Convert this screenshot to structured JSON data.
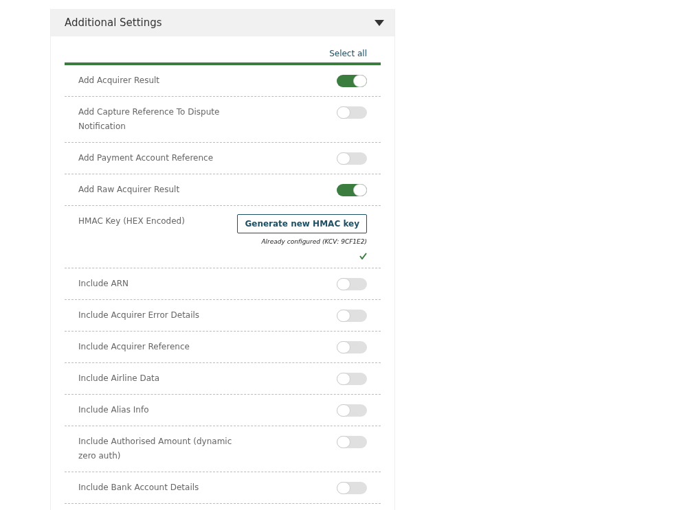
{
  "panel": {
    "title": "Additional Settings",
    "expanded": true
  },
  "select_all": "Select all",
  "settings": [
    {
      "kind": "toggle",
      "label": "Add Acquirer Result",
      "on": true
    },
    {
      "kind": "toggle",
      "label": "Add Capture Reference To Dispute Notification",
      "on": false
    },
    {
      "kind": "toggle",
      "label": "Add Payment Account Reference",
      "on": false
    },
    {
      "kind": "toggle",
      "label": "Add Raw Acquirer Result",
      "on": true
    },
    {
      "kind": "key",
      "label": "HMAC Key (HEX Encoded)",
      "button": "Generate new HMAC key",
      "note": "Already configured (KCV: 9CF1E2)",
      "configured": true
    },
    {
      "kind": "toggle",
      "label": "Include ARN",
      "on": false
    },
    {
      "kind": "toggle",
      "label": "Include Acquirer Error Details",
      "on": false
    },
    {
      "kind": "toggle",
      "label": "Include Acquirer Reference",
      "on": false
    },
    {
      "kind": "toggle",
      "label": "Include Airline Data",
      "on": false
    },
    {
      "kind": "toggle",
      "label": "Include Alias Info",
      "on": false
    },
    {
      "kind": "toggle",
      "label": "Include Authorised Amount (dynamic zero auth)",
      "on": false
    },
    {
      "kind": "toggle",
      "label": "Include Bank Account Details",
      "on": false
    }
  ]
}
